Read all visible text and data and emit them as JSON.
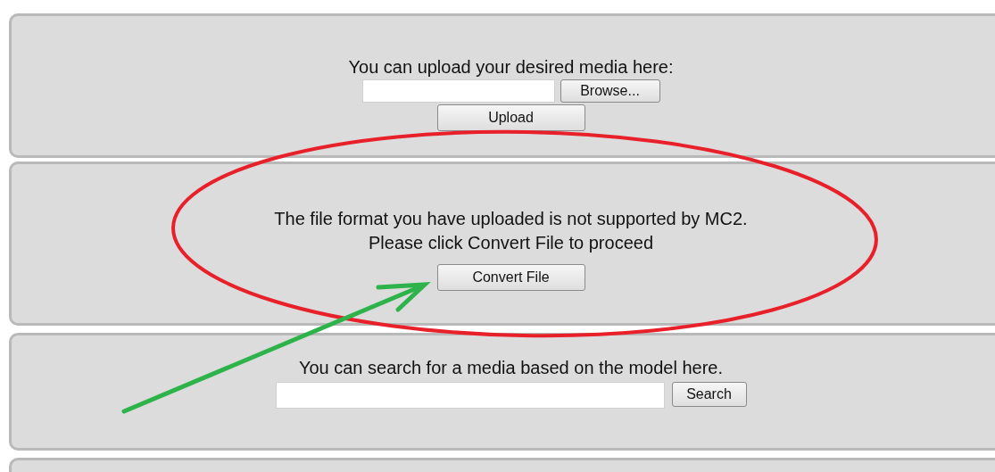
{
  "upload_panel": {
    "prompt": "You can upload your desired media here:",
    "browse_button": "Browse...",
    "upload_button": "Upload"
  },
  "convert_panel": {
    "message_lines": [
      "The file format you have uploaded is not supported by MC2.",
      "Please click Convert File to proceed"
    ],
    "convert_button": "Convert File"
  },
  "search_panel": {
    "prompt": "You can search for a media based on the model here.",
    "search_button": "Search"
  },
  "annotations": [
    {
      "kind": "ellipse"
    },
    {
      "kind": "arrow"
    }
  ]
}
